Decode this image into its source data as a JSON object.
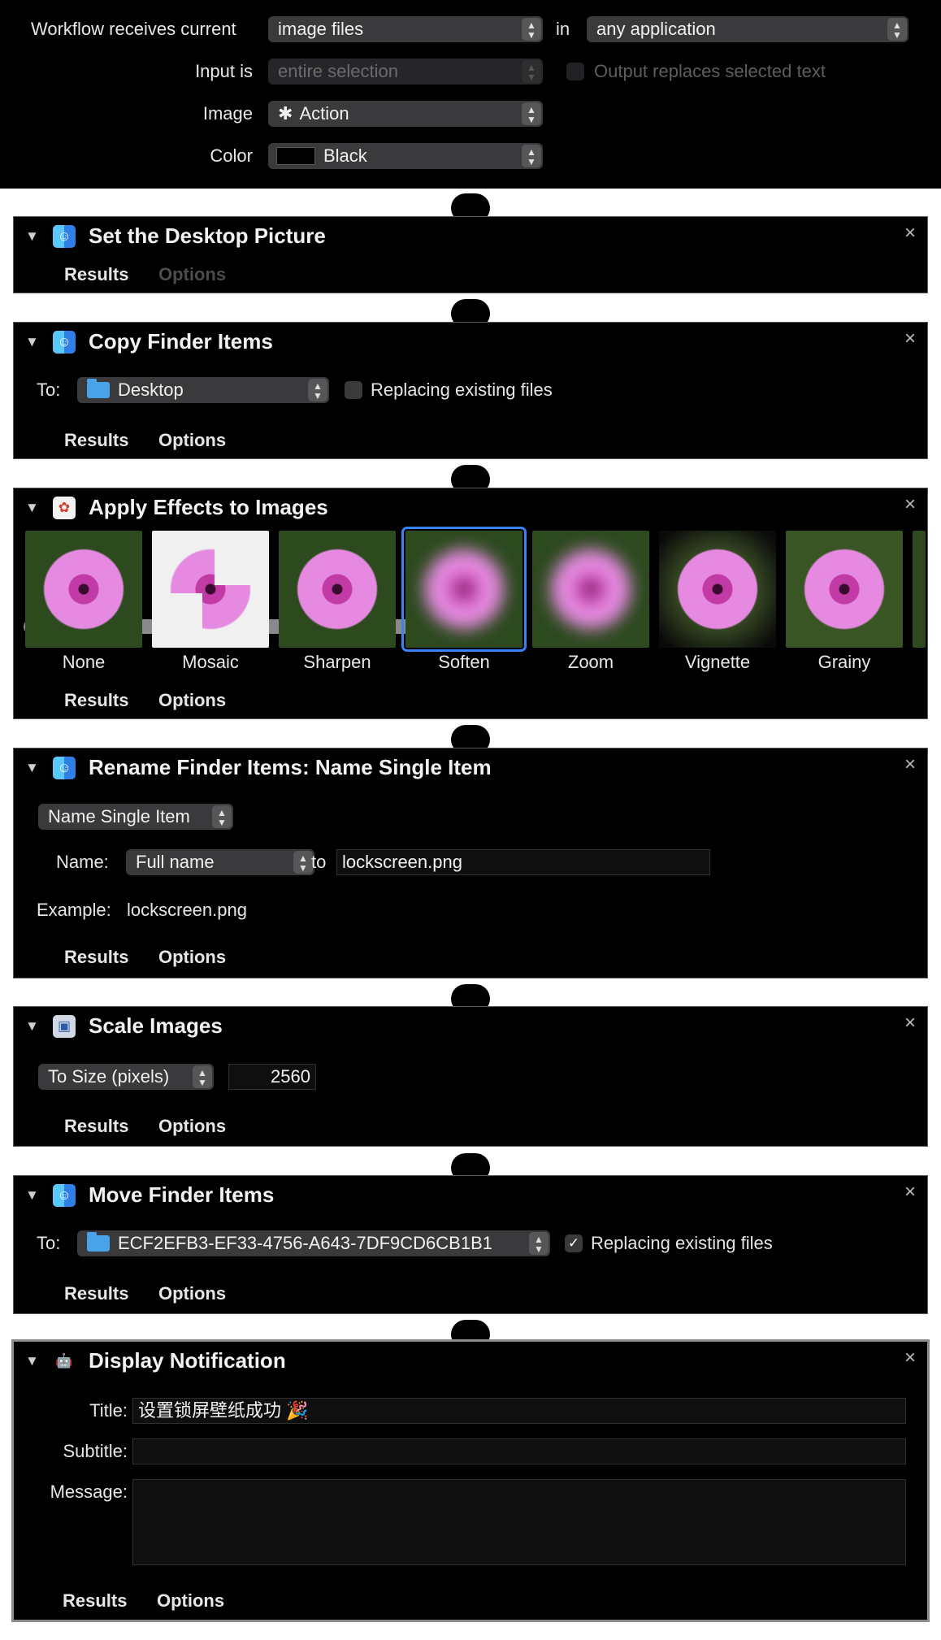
{
  "header": {
    "receives_label": "Workflow receives current",
    "receives_value": "image files",
    "in_label": "in",
    "application_value": "any application",
    "input_is_label": "Input is",
    "input_is_value": "entire selection",
    "output_replaces_label": "Output replaces selected text",
    "output_replaces_checked": false,
    "image_label": "Image",
    "image_value": "Action",
    "color_label": "Color",
    "color_value": "Black"
  },
  "tabs": {
    "results": "Results",
    "options": "Options"
  },
  "actions": {
    "desktop_picture": {
      "title": "Set the Desktop Picture"
    },
    "copy_finder": {
      "title": "Copy Finder Items",
      "to_label": "To:",
      "to_value": "Desktop",
      "replacing_label": "Replacing existing files",
      "replacing_checked": false
    },
    "apply_effects": {
      "title": "Apply Effects to Images",
      "effects": [
        "None",
        "Mosaic",
        "Sharpen",
        "Soften",
        "Zoom",
        "Vignette",
        "Grainy"
      ],
      "selected_effect": "Soften"
    },
    "rename": {
      "title": "Rename Finder Items: Name Single Item",
      "mode_value": "Name Single Item",
      "name_label": "Name:",
      "name_value": "Full name",
      "to_label": "to",
      "to_value": "lockscreen.png",
      "example_label": "Example:",
      "example_value": "lockscreen.png"
    },
    "scale": {
      "title": "Scale Images",
      "mode_value": "To Size (pixels)",
      "size_value": "2560"
    },
    "move_finder": {
      "title": "Move Finder Items",
      "to_label": "To:",
      "to_value": "ECF2EFB3-EF33-4756-A643-7DF9CD6CB1B1",
      "replacing_label": "Replacing existing files",
      "replacing_checked": true
    },
    "notification": {
      "title": "Display Notification",
      "title_label": "Title:",
      "title_value": "设置锁屏壁纸成功 🎉",
      "subtitle_label": "Subtitle:",
      "subtitle_value": "",
      "message_label": "Message:",
      "message_value": ""
    }
  },
  "icons": {
    "disclosure": "▼",
    "close": "×",
    "stepper": "⌃⌄",
    "gear": "✱",
    "check": "✓",
    "finder": "finder-icon",
    "photo": "photos-icon",
    "preview": "preview-icon",
    "script": "automator-icon"
  },
  "colors": {
    "background": "#000000",
    "selection": "#3b82f6",
    "folder": "#4aa3e8"
  }
}
